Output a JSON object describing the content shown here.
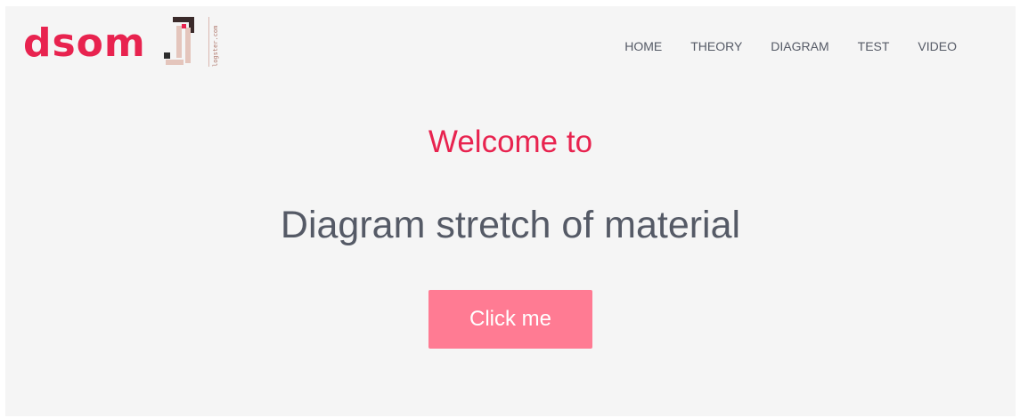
{
  "brand": {
    "name": "dsom",
    "domain": "logster.com",
    "color": "#e8234f"
  },
  "nav": {
    "items": [
      {
        "label": "HOME"
      },
      {
        "label": "THEORY"
      },
      {
        "label": "DIAGRAM"
      },
      {
        "label": "TEST"
      },
      {
        "label": "VIDEO"
      }
    ]
  },
  "hero": {
    "welcome": "Welcome to",
    "title": "Diagram stretch of material",
    "button_label": "Click me",
    "button_color": "#ff7b93",
    "text_color": "#555a66"
  }
}
